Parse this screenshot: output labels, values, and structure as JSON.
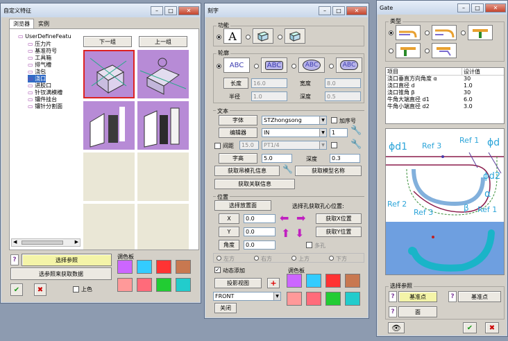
{
  "win1": {
    "title": "自定义特征",
    "tabs": [
      "浏览器",
      "实例"
    ],
    "tree_root": "UserDefineFeatu",
    "tree": [
      "压力片",
      "基准符号",
      "工具箱",
      "排气槽",
      "浇包",
      "浇口",
      "进胶口",
      "针钗满模槽",
      "镶件挂台",
      "镶针分割面"
    ],
    "next_group": "下一组",
    "prev_group": "上一组",
    "select_ref": "选择参照",
    "get_data": "选参照来获取数据",
    "palette": "调色板",
    "upper_color": "上色",
    "palette_colors": [
      "#cc66ff",
      "#33ccff",
      "#ff3333",
      "#c87850",
      "#ff9999",
      "#ff6b7a",
      "#22cc33",
      "#22cccc"
    ]
  },
  "win2": {
    "title": "刻字",
    "func_group": "功能",
    "outline_group": "轮廓",
    "abc": "ABC",
    "length_label": "长度",
    "length_val": "16.0",
    "width_label": "宽度",
    "width_val": "8.0",
    "radius_label": "半径",
    "radius_val": "1.0",
    "depth_label": "深度",
    "depth_val": "0.5",
    "text_group": "文本",
    "font_btn": "字体",
    "font_val": "STZhongsong",
    "serial_label": "加序号",
    "editor_btn": "编辑器",
    "editor_val": "IN",
    "editor_num": "1",
    "spacing_label": "间距",
    "spacing_val": "15.0",
    "pt_val": "PT1/4",
    "height_btn": "字高",
    "height_val": "5.0",
    "depth2_label": "深度",
    "depth2_val": "0.3",
    "get_hole_info": "获取吊模孔信息",
    "get_model_name": "获取模型名称",
    "get_related": "获取关联信息",
    "pos_group": "位置",
    "select_plane": "选择放置面",
    "select_hole": "选择孔获取孔心位置:",
    "x_label": "X",
    "x_val": "0.0",
    "y_label": "Y",
    "y_val": "0.0",
    "angle_label": "角度",
    "angle_val": "0.0",
    "get_x": "获取X位置",
    "get_y": "获取Y位置",
    "multi_hole": "多孔",
    "left": "左方",
    "right": "右方",
    "up": "上方",
    "down": "下方",
    "dynamic_add": "动态添加",
    "projection": "投影视图",
    "view_val": "FRONT",
    "close": "关闭",
    "palette": "调色板",
    "palette_colors": [
      "#cc66ff",
      "#33ccff",
      "#ff3333",
      "#c87850",
      "#ff9999",
      "#ff6b7a",
      "#22cc33",
      "#22cccc"
    ]
  },
  "win3": {
    "title": "Gate",
    "type_group": "类型",
    "table_head": [
      "项目",
      "设计值"
    ],
    "table_rows": [
      [
        "浇口垂直方向角度 α",
        "30"
      ],
      [
        "浇口直径 d",
        "1.0"
      ],
      [
        "浇口锥角 β",
        "30"
      ],
      [
        "牛角大端直径 d1",
        "6.0"
      ],
      [
        "牛角小端直径 d2",
        "3.0"
      ]
    ],
    "diag_d1": "ϕd1",
    "diag_ref3a": "Ref 3",
    "diag_ref1a": "Ref 1",
    "diag_d": "ϕd",
    "diag_d2": "ϕd2",
    "diag_alpha": "α",
    "diag_ref2": "Ref 2",
    "diag_ref3b": "Ref 3",
    "diag_beta": "β",
    "diag_ref1b": "Ref 1",
    "select_ref_group": "选择参照",
    "datum_point": "基准点",
    "datum_point2": "基准点",
    "face": "面"
  }
}
